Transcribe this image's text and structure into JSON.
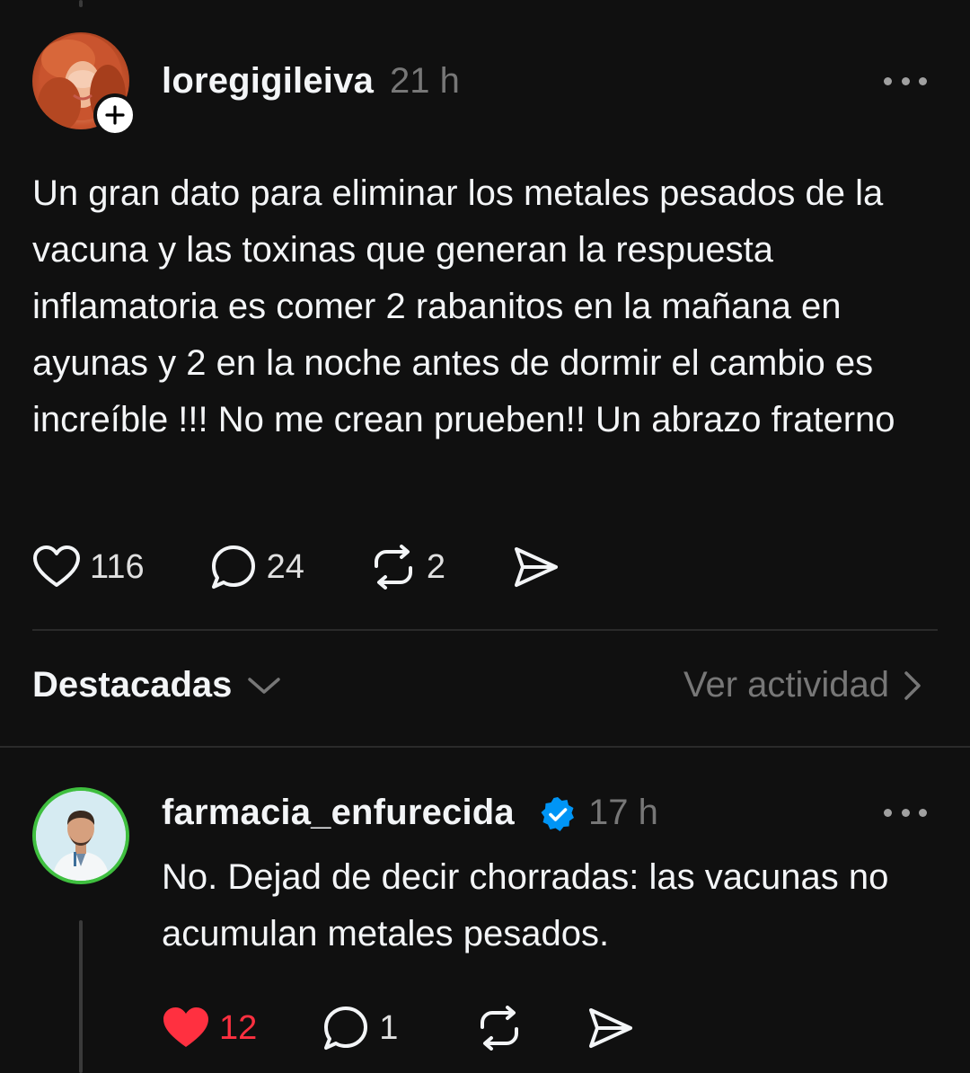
{
  "post": {
    "username": "loregigileiva",
    "time": "21 h",
    "text": "Un gran dato para eliminar los metales pesados de la vacuna y las toxinas que generan la respuesta inflamatoria es comer 2 rabanitos en la mañana en ayunas y 2 en la noche antes de dormir el cambio es increíble !!! No me crean prueben!! Un abrazo fraterno",
    "likes": "116",
    "comments": "24",
    "reposts": "2",
    "liked": false
  },
  "section": {
    "title": "Destacadas",
    "view_activity": "Ver actividad"
  },
  "reply": {
    "username": "farmacia_enfurecida",
    "verified": true,
    "time": "17 h",
    "text": "No. Dejad de decir chorradas: las vacunas no acumulan metales pesados.",
    "likes": "12",
    "comments": "1",
    "liked": true
  },
  "colors": {
    "background": "#101010",
    "text": "#f3f5f7",
    "muted": "#777777",
    "like_active": "#ff3040",
    "verified": "#0095f6",
    "avatar_ring": "#3fbf3f"
  }
}
